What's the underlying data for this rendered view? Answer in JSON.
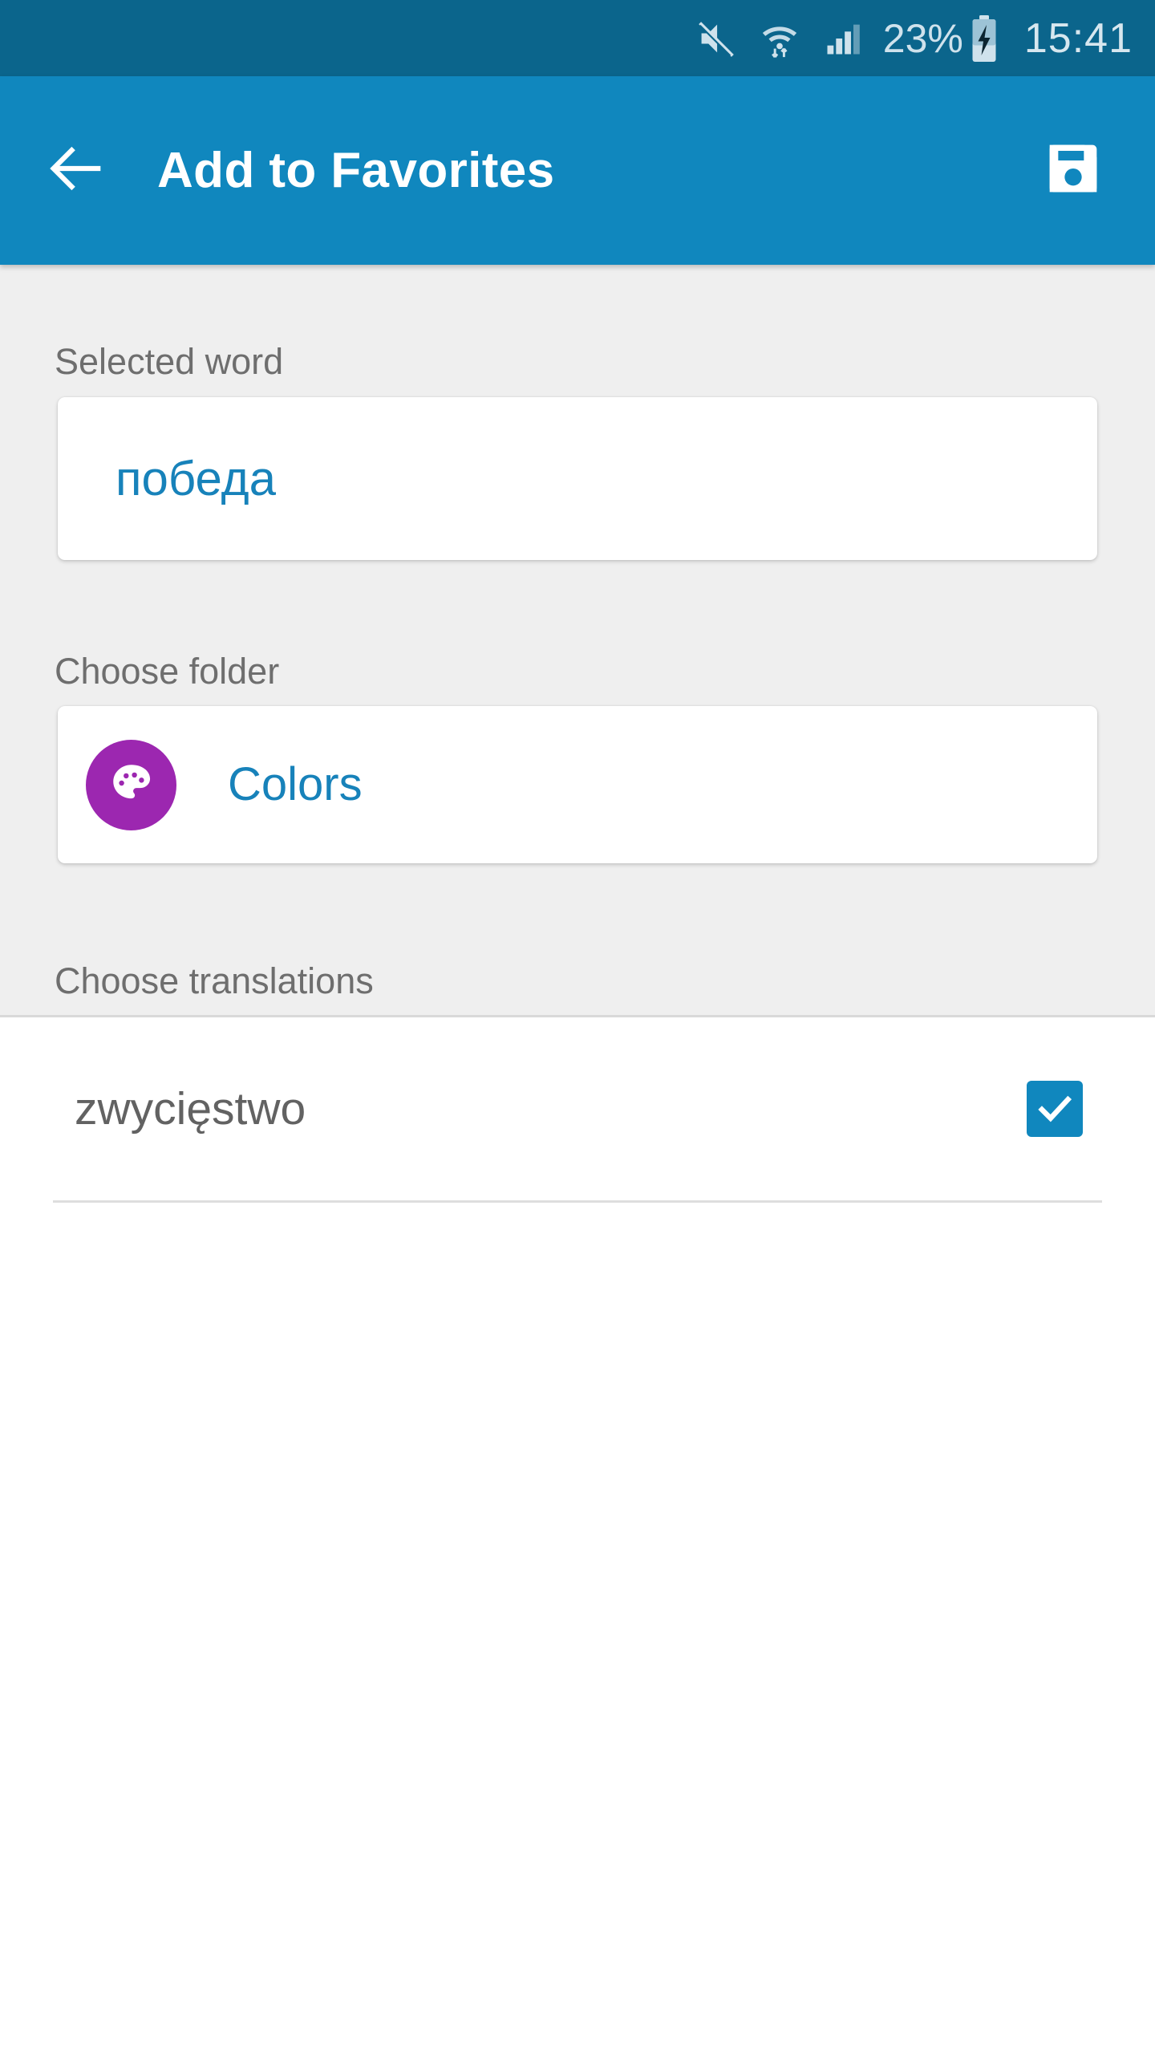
{
  "status_bar": {
    "mute_icon": "mute-icon",
    "wifi_icon": "wifi-icon",
    "signal_icon": "cellular-signal-icon",
    "battery_percent": "23%",
    "battery_icon": "battery-charging-icon",
    "clock": "15:41",
    "background_color": "#0b658c",
    "text_color": "#cfe2ec"
  },
  "app_bar": {
    "back_icon": "back-arrow-icon",
    "title": "Add to Favorites",
    "save_icon": "save-floppy-disk-icon",
    "background_color": "#1087be",
    "title_color": "#ffffff"
  },
  "form": {
    "background_color": "#efefef",
    "selected_word": {
      "label": "Selected word",
      "value": "победа",
      "value_color": "#1782ba"
    },
    "choose_folder": {
      "label": "Choose folder",
      "folder_name": "Colors",
      "folder_icon": "palette-icon",
      "avatar_color": "#9c27b0",
      "name_color": "#1782ba"
    },
    "choose_translations": {
      "label": "Choose translations"
    }
  },
  "translations": {
    "items": [
      {
        "text": "zwycięstwo",
        "checked": true
      }
    ],
    "checkbox_color": "#1087be",
    "text_color": "#626262"
  }
}
